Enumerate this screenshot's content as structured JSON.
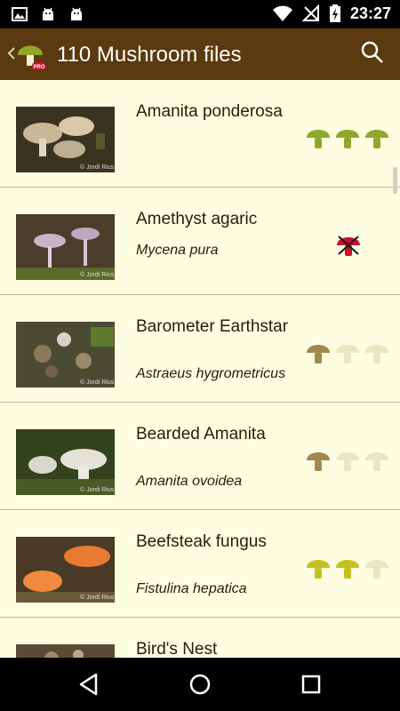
{
  "status": {
    "time": "23:27"
  },
  "header": {
    "title": "110 Mushroom files"
  },
  "colors": {
    "toolbar": "#5a3a0e",
    "list_bg": "#fcfde1",
    "edible_good": "#8ea82a",
    "edible": "#c4c020",
    "faded": "#e6e8c4",
    "uncertain": "#a08850",
    "toxic": "#c8102e"
  },
  "mushrooms": [
    {
      "name": "Amanita ponderosa",
      "latin": "",
      "credit": "© Jordi Rius",
      "rating": [
        "good",
        "good",
        "good"
      ]
    },
    {
      "name": "Amethyst agaric",
      "latin": "Mycena pura",
      "credit": "© Jordi Rius",
      "rating": [
        "toxic"
      ]
    },
    {
      "name": "Barometer Earthstar",
      "latin": "Astraeus hygrometricus",
      "credit": "© Jordi Rius",
      "rating": [
        "uncertain",
        "faded",
        "faded"
      ]
    },
    {
      "name": "Bearded Amanita",
      "latin": "Amanita ovoidea",
      "credit": "© Jordi Rius",
      "rating": [
        "uncertain",
        "faded",
        "faded"
      ]
    },
    {
      "name": "Beefsteak fungus",
      "latin": "Fistulina hepatica",
      "credit": "© Jordi Rius",
      "rating": [
        "edible",
        "edible",
        "faded"
      ]
    },
    {
      "name": "Bird's Nest",
      "latin": "",
      "credit": "",
      "rating": []
    }
  ],
  "icons": {
    "status_left": [
      "image-icon",
      "android-icon",
      "android-icon"
    ],
    "status_right": [
      "wifi-icon",
      "no-signal-icon",
      "battery-charging-icon"
    ],
    "search": "search-icon",
    "nav": [
      "back-icon",
      "home-icon",
      "recents-icon"
    ]
  }
}
